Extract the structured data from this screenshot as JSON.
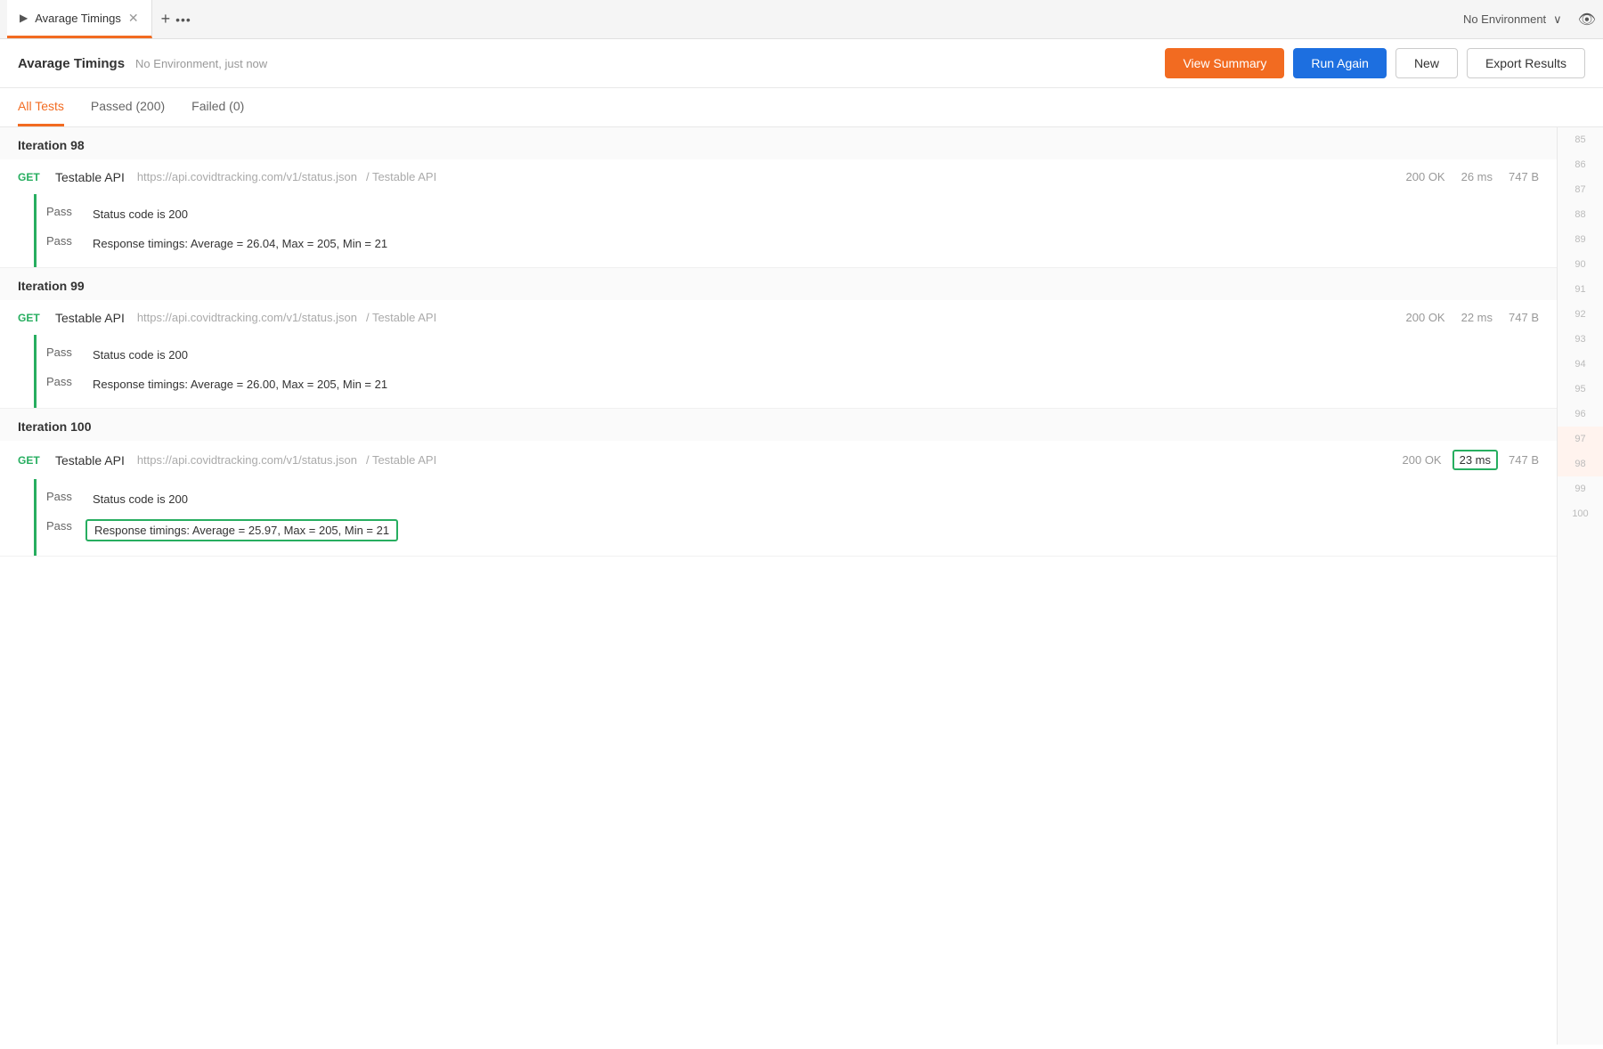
{
  "tabBar": {
    "tabTitle": "Avarage Timings",
    "playIcon": "▶",
    "closeIcon": "✕",
    "addIcon": "+",
    "dotsIcon": "•••",
    "envLabel": "No Environment",
    "chevronIcon": "∨",
    "eyeIcon": "👁"
  },
  "header": {
    "title": "Avarage Timings",
    "subtitle": "No Environment, just now",
    "viewSummaryLabel": "View Summary",
    "runAgainLabel": "Run Again",
    "newLabel": "New",
    "exportLabel": "Export Results"
  },
  "tabs": {
    "allTests": "All Tests",
    "passed": "Passed (200)",
    "failed": "Failed (0)"
  },
  "iterations": [
    {
      "id": "iter98",
      "label": "Iteration 98",
      "request": {
        "method": "GET",
        "name": "Testable API",
        "url": "https://api.covidtracking.com/v1/status.json",
        "path": "/ Testable API",
        "statusCode": "200 OK",
        "timing": "26 ms",
        "timingHighlighted": false,
        "size": "747 B"
      },
      "tests": [
        {
          "label": "Pass",
          "text": "Status code is 200",
          "highlighted": false
        },
        {
          "label": "Pass",
          "text": "Response timings: Average = 26.04, Max = 205, Min = 21",
          "highlighted": false
        }
      ]
    },
    {
      "id": "iter99",
      "label": "Iteration 99",
      "request": {
        "method": "GET",
        "name": "Testable API",
        "url": "https://api.covidtracking.com/v1/status.json",
        "path": "/ Testable API",
        "statusCode": "200 OK",
        "timing": "22 ms",
        "timingHighlighted": false,
        "size": "747 B"
      },
      "tests": [
        {
          "label": "Pass",
          "text": "Status code is 200",
          "highlighted": false
        },
        {
          "label": "Pass",
          "text": "Response timings: Average = 26.00, Max = 205, Min = 21",
          "highlighted": false
        }
      ]
    },
    {
      "id": "iter100",
      "label": "Iteration 100",
      "request": {
        "method": "GET",
        "name": "Testable API",
        "url": "https://api.covidtracking.com/v1/status.json",
        "path": "/ Testable API",
        "statusCode": "200 OK",
        "timing": "23 ms",
        "timingHighlighted": true,
        "size": "747 B"
      },
      "tests": [
        {
          "label": "Pass",
          "text": "Status code is 200",
          "highlighted": false
        },
        {
          "label": "Pass",
          "text": "Response timings: Average = 25.97, Max = 205, Min = 21",
          "highlighted": true
        }
      ]
    }
  ],
  "lineNumbers": [
    85,
    86,
    87,
    88,
    89,
    90,
    91,
    92,
    93,
    94,
    95,
    96,
    97,
    98,
    99,
    100
  ],
  "activeLineNumbers": [
    97,
    98
  ]
}
